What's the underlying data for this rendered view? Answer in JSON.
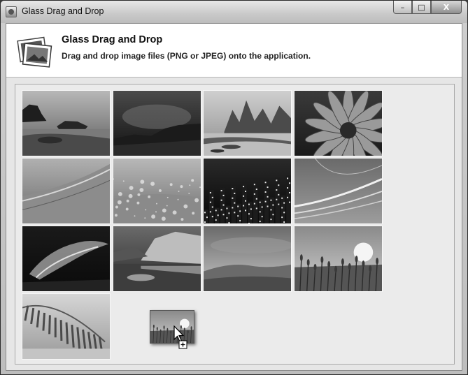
{
  "window": {
    "title": "Glass Drag and Drop",
    "controls": {
      "minimize": "–",
      "maximize": "□",
      "close": "X"
    }
  },
  "header": {
    "title": "Glass Drag and Drop",
    "subtitle": "Drag and drop image files (PNG or JPEG) onto the application.",
    "icon": "photos-icon"
  },
  "gallery": {
    "thumbnails": [
      {
        "name": "rocky-coast",
        "kind": "coast"
      },
      {
        "name": "dark-dusk-hills",
        "kind": "dusk"
      },
      {
        "name": "karst-river",
        "kind": "karst"
      },
      {
        "name": "flower-closeup",
        "kind": "flower"
      },
      {
        "name": "palm-leaf-detail",
        "kind": "leaf"
      },
      {
        "name": "dew-grass",
        "kind": "grass"
      },
      {
        "name": "night-city",
        "kind": "city"
      },
      {
        "name": "abstract-light",
        "kind": "abstract"
      },
      {
        "name": "aurora",
        "kind": "aurora"
      },
      {
        "name": "mountain-lake",
        "kind": "lake"
      },
      {
        "name": "sunset-hills",
        "kind": "hills"
      },
      {
        "name": "reeds-sunrise",
        "kind": "reeds"
      },
      {
        "name": "palm-frond-beach",
        "kind": "palm"
      }
    ],
    "drag_item": {
      "name": "reeds-sunrise",
      "kind": "reeds"
    }
  }
}
